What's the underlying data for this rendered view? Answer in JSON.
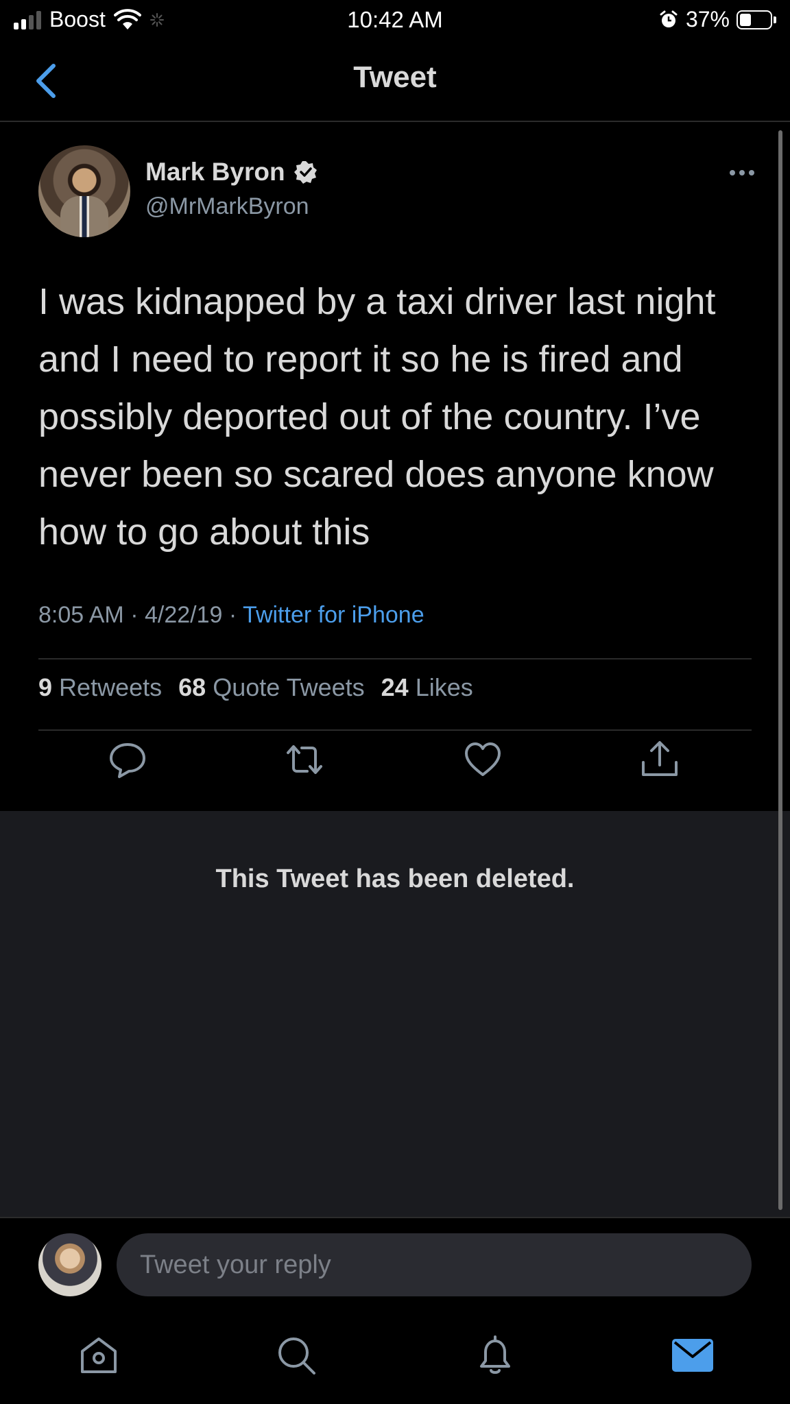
{
  "status_bar": {
    "carrier": "Boost",
    "time": "10:42 AM",
    "battery_percent": "37%",
    "battery_level": 0.37
  },
  "nav": {
    "title": "Tweet"
  },
  "tweet": {
    "display_name": "Mark Byron",
    "handle": "@MrMarkByron",
    "verified": true,
    "text": "I was kidnapped by a taxi driver last night and I need to report it so he is fired and possibly deported out of the country. I’ve never been so scared does anyone know how to go about this",
    "time": "8:05 AM",
    "date": "4/22/19",
    "source": "Twitter for iPhone",
    "stats": {
      "retweets_count": "9",
      "retweets_label": "Retweets",
      "quotes_count": "68",
      "quotes_label": "Quote Tweets",
      "likes_count": "24",
      "likes_label": "Likes"
    }
  },
  "deleted_notice": "This Tweet has been deleted.",
  "reply": {
    "placeholder": "Tweet your reply"
  },
  "colors": {
    "accent": "#4c9eeb",
    "background": "#000000",
    "deleted_bg": "#1a1b1f"
  }
}
